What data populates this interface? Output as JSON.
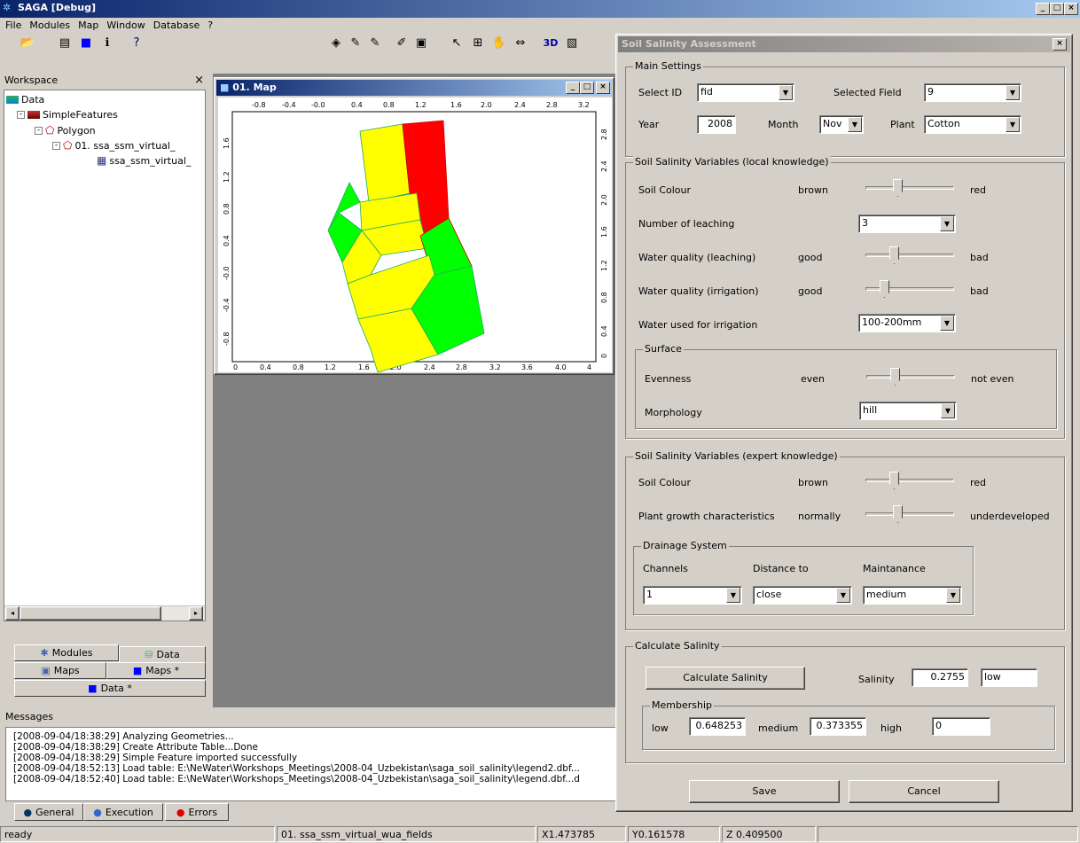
{
  "app": {
    "title": "SAGA [Debug]"
  },
  "menu": [
    "File",
    "Modules",
    "Map",
    "Window",
    "Database",
    "?"
  ],
  "workspace": {
    "title": "Workspace",
    "tree": [
      "Data",
      "SimpleFeatures",
      "Polygon",
      "01. ssa_ssm_virtual_",
      "ssa_ssm_virtual_"
    ],
    "tabs": {
      "modules": "Modules",
      "data": "Data",
      "maps": "Maps",
      "maps_star": "Maps *",
      "data_star": "Data *"
    }
  },
  "map_window": {
    "title": "01. Map",
    "top_ticks": [
      "-0.8",
      "-0.4",
      "-0.0",
      "0.4",
      "0.8",
      "1.2",
      "1.6",
      "2.0",
      "2.4",
      "2.8",
      "3.2"
    ],
    "bottom_ticks": [
      "0",
      "0.4",
      "0.8",
      "1.2",
      "1.6",
      "2.0",
      "2.4",
      "2.8",
      "3.2",
      "3.6",
      "4.0",
      "4"
    ],
    "left_ticks": [
      "1.6",
      "1.2",
      "0.8",
      "0.4",
      "-0.0",
      "-0.4",
      "-0.8"
    ],
    "right_ticks": [
      "2.8",
      "2.4",
      "2.0",
      "1.6",
      "1.2",
      "0.8",
      "0.4",
      "0"
    ]
  },
  "messages": {
    "title": "Messages",
    "lines": [
      "[2008-09-04/18:38:29] Analyzing Geometries...",
      "[2008-09-04/18:38:29] Create Attribute Table...Done",
      "[2008-09-04/18:38:29] Simple Feature imported successfully",
      "[2008-09-04/18:52:13] Load table: E:\\NeWater\\Workshops_Meetings\\2008-04_Uzbekistan\\saga_soil_salinity\\legend2.dbf...",
      "[2008-09-04/18:52:40] Load table: E:\\NeWater\\Workshops_Meetings\\2008-04_Uzbekistan\\saga_soil_salinity\\legend.dbf...d"
    ],
    "tabs": {
      "general": "General",
      "execution": "Execution",
      "errors": "Errors"
    }
  },
  "status": {
    "ready": "ready",
    "layer": "01. ssa_ssm_virtual_wua_fields",
    "x": "X1.473785",
    "y": "Y0.161578",
    "z": "Z 0.409500"
  },
  "dialog": {
    "title": "Soil Salinity Assessment",
    "main": {
      "label": "Main Settings",
      "select_id_label": "Select ID",
      "select_id": "fid",
      "selected_field_label": "Selected Field",
      "selected_field": "9",
      "year_label": "Year",
      "year": "2008",
      "month_label": "Month",
      "month": "Nov",
      "plant_label": "Plant",
      "plant": "Cotton"
    },
    "local": {
      "label": "Soil Salinity Variables (local knowledge)",
      "soil_colour": {
        "label": "Soil Colour",
        "min": "brown",
        "max": "red",
        "level": 0.35
      },
      "leaching": {
        "label": "Number of leaching",
        "value": "3"
      },
      "wq_leach": {
        "label": "Water quality (leaching)",
        "min": "good",
        "max": "bad",
        "level": 0.3
      },
      "wq_irr": {
        "label": "Water quality (irrigation)",
        "min": "good",
        "max": "bad",
        "level": 0.18
      },
      "water_used": {
        "label": "Water used for irrigation",
        "value": "100-200mm"
      },
      "surface": {
        "label": "Surface",
        "evenness": {
          "label": "Evenness",
          "min": "even",
          "max": "not even",
          "level": 0.3
        },
        "morphology": {
          "label": "Morphology",
          "value": "hill"
        }
      }
    },
    "expert": {
      "label": "Soil Salinity Variables (expert knowledge)",
      "soil_colour": {
        "label": "Soil Colour",
        "min": "brown",
        "max": "red",
        "level": 0.3
      },
      "plant_growth": {
        "label": "Plant growth characteristics",
        "min": "normally",
        "max": "underdeveloped",
        "level": 0.35
      },
      "drainage": {
        "label": "Drainage System",
        "channels_label": "Channels",
        "distance_label": "Distance to",
        "maint_label": "Maintanance",
        "channels": "1",
        "distance": "close",
        "maint": "medium"
      }
    },
    "calc": {
      "label": "Calculate Salinity",
      "button": "Calculate Salinity",
      "salinity_label": "Salinity",
      "salinity": "0.2755",
      "salinity_class": "low",
      "membership": {
        "label": "Membership",
        "low_label": "low",
        "low": "0.648253",
        "medium_label": "medium",
        "medium": "0.373355",
        "high_label": "high",
        "high": "0"
      }
    },
    "save": "Save",
    "cancel": "Cancel"
  },
  "colors": {
    "yellow": "#ffff00",
    "green": "#00ff00",
    "red": "#ff0000"
  }
}
